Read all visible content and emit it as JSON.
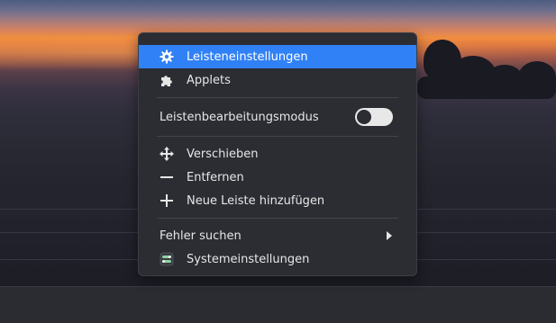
{
  "menu": {
    "items": [
      {
        "label": "Leisteneinstellungen",
        "icon": "gear-icon"
      },
      {
        "label": "Applets",
        "icon": "puzzle-icon"
      }
    ],
    "toggle": {
      "label": "Leistenbearbeitungsmodus",
      "state": "off"
    },
    "actions": [
      {
        "label": "Verschieben",
        "icon": "move-icon"
      },
      {
        "label": "Entfernen",
        "icon": "minus-icon"
      },
      {
        "label": "Neue Leiste hinzufügen",
        "icon": "plus-icon"
      }
    ],
    "troubleshoot": {
      "label": "Fehler suchen",
      "icon": "chevron-right-icon"
    },
    "system": {
      "label": "Systemeinstellungen",
      "icon": "system-settings-icon"
    }
  },
  "colors": {
    "highlight": "#3081f6",
    "menu_bg": "#2c2d33",
    "panel_bg": "#2b2c31"
  }
}
